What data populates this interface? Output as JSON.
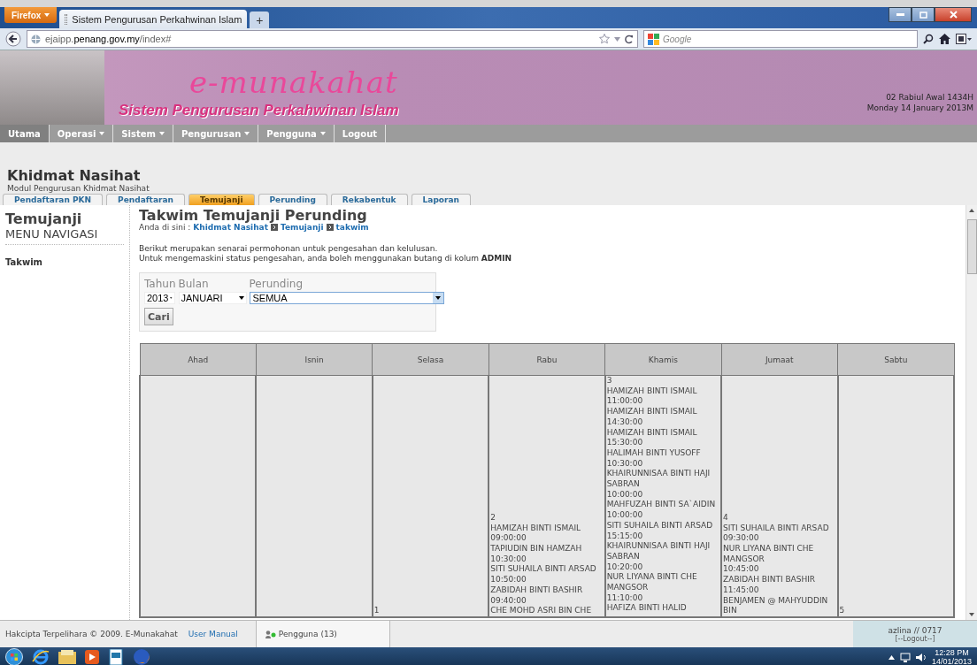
{
  "browser": {
    "menu_button": "Firefox",
    "tab_title": "Sistem Pengurusan Perkahwinan Islam",
    "new_tab": "+",
    "url": "ejaipp.**penang.gov.my**/index#",
    "search_placeholder": "Google"
  },
  "header": {
    "logo": "e-munakahat",
    "subtitle": "Sistem Pengurusan Perkahwinan Islam",
    "hijri_date": "02 Rabiul Awal 1434H",
    "date": "Monday 14 January 2013M"
  },
  "nav": [
    {
      "label": "Utama",
      "dropdown": false,
      "selected": true
    },
    {
      "label": "Operasi",
      "dropdown": true,
      "selected": false
    },
    {
      "label": "Sistem",
      "dropdown": true,
      "selected": false
    },
    {
      "label": "Pengurusan",
      "dropdown": true,
      "selected": false
    },
    {
      "label": "Pengguna",
      "dropdown": true,
      "selected": false
    },
    {
      "label": "Logout",
      "dropdown": false,
      "selected": false
    }
  ],
  "module": {
    "title": "Khidmat Nasihat",
    "subtitle": "Modul Pengurusan Khidmat Nasihat"
  },
  "tabs": [
    {
      "label": "Pendaftaran PKN",
      "selected": false
    },
    {
      "label": "Pendaftaran",
      "selected": false
    },
    {
      "label": "Temujanji",
      "selected": true
    },
    {
      "label": "Perunding",
      "selected": false
    },
    {
      "label": "Rekabentuk",
      "selected": false
    },
    {
      "label": "Laporan",
      "selected": false
    }
  ],
  "sidebar": {
    "title": "Temujanji",
    "subtitle": "MENU NAVIGASI",
    "items": [
      {
        "label": "Takwim"
      }
    ]
  },
  "page": {
    "title": "Takwim Temujanji Perunding",
    "breadcrumb_label": "Anda di sini :",
    "breadcrumb": [
      "Khidmat Nasihat",
      "Temujanji",
      "takwim"
    ],
    "intro": [
      "Berikut merupakan senarai permohonan untuk pengesahan dan kelulusan.",
      "Untuk mengemaskini status pengesahan, anda boleh menggunakan butang di kolum **ADMIN**"
    ]
  },
  "filter": {
    "fields": [
      {
        "label": "Tahun",
        "value": "2013",
        "kind": "select"
      },
      {
        "label": "Bulan",
        "value": "JANUARI",
        "kind": "select"
      },
      {
        "label": "Perunding",
        "value": "SEMUA",
        "kind": "combo"
      }
    ],
    "button": "Cari"
  },
  "calendar": {
    "days": [
      "Ahad",
      "Isnin",
      "Selasa",
      "Rabu",
      "Khamis",
      "Jumaat",
      "Sabtu"
    ],
    "cells": [
      {},
      {},
      {
        "date": "1"
      },
      {
        "date": "2",
        "entries": [
          {
            "name": "HAMIZAH BINTI ISMAIL",
            "time": "09:00:00"
          },
          {
            "name": "TAPIUDIN BIN HAMZAH",
            "time": "10:30:00"
          },
          {
            "name": "SITI SUHAILA BINTI ARSAD",
            "time": "10:50:00"
          },
          {
            "name": "ZABIDAH BINTI BASHIR",
            "time": "09:40:00"
          },
          {
            "name": "CHE MOHD ASRI BIN CHE"
          }
        ]
      },
      {
        "date": "3",
        "entries": [
          {
            "name": "HAMIZAH BINTI ISMAIL",
            "time": "11:00:00"
          },
          {
            "name": "HAMIZAH BINTI ISMAIL",
            "time": "14:30:00"
          },
          {
            "name": "HAMIZAH BINTI ISMAIL",
            "time": "15:30:00"
          },
          {
            "name": "HALIMAH BINTI YUSOFF",
            "time": "10:30:00"
          },
          {
            "name": "KHAIRUNNISAA BINTI HAJI SABRAN",
            "time": "10:00:00"
          },
          {
            "name": "MAHFUZAH BINTI SA`AIDIN",
            "time": "10:00:00"
          },
          {
            "name": "SITI SUHAILA BINTI ARSAD",
            "time": "15:15:00"
          },
          {
            "name": "KHAIRUNNISAA BINTI HAJI SABRAN",
            "time": "10:20:00"
          },
          {
            "name": "NUR LIYANA BINTI CHE MANGSOR",
            "time": "11:10:00"
          },
          {
            "name": "HAFIZA BINTI HALID"
          }
        ]
      },
      {
        "date": "4",
        "entries": [
          {
            "name": "SITI SUHAILA BINTI ARSAD",
            "time": "09:30:00"
          },
          {
            "name": "NUR LIYANA BINTI CHE MANGSOR",
            "time": "10:45:00"
          },
          {
            "name": "ZABIDAH BINTI BASHIR",
            "time": "11:45:00"
          },
          {
            "name": "BENJAMEN @ MAHYUDDIN BIN"
          }
        ]
      },
      {
        "date": "5"
      }
    ]
  },
  "footer": {
    "copyright": "Hakcipta Terpelihara © 2009. E-Munakahat",
    "manual_link": "User Manual",
    "users": "Pengguna (13)",
    "user": "azlina // 0717",
    "logout": "[--Logout--]"
  },
  "taskbar": {
    "time": "12:28 PM",
    "date": "14/01/2013"
  }
}
